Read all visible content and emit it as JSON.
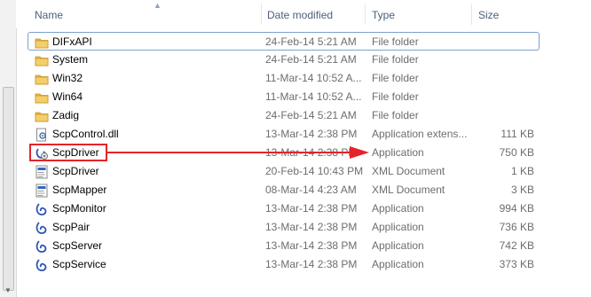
{
  "header": {
    "name": "Name",
    "date": "Date modified",
    "type": "Type",
    "size": "Size"
  },
  "rows": [
    {
      "name": "DIFxAPI",
      "date": "24-Feb-14 5:21 AM",
      "type": "File folder",
      "size": "",
      "icon": "folder-icon"
    },
    {
      "name": "System",
      "date": "24-Feb-14 5:21 AM",
      "type": "File folder",
      "size": "",
      "icon": "folder-icon"
    },
    {
      "name": "Win32",
      "date": "11-Mar-14 10:52 A...",
      "type": "File folder",
      "size": "",
      "icon": "folder-icon"
    },
    {
      "name": "Win64",
      "date": "11-Mar-14 10:52 A...",
      "type": "File folder",
      "size": "",
      "icon": "folder-icon"
    },
    {
      "name": "Zadig",
      "date": "24-Feb-14 5:21 AM",
      "type": "File folder",
      "size": "",
      "icon": "folder-icon"
    },
    {
      "name": "ScpControl.dll",
      "date": "13-Mar-14 2:38 PM",
      "type": "Application extens...",
      "size": "111 KB",
      "icon": "dll-icon"
    },
    {
      "name": "ScpDriver",
      "date": "13-Mar-14 2:38 PM",
      "type": "Application",
      "size": "750 KB",
      "icon": "installer-app-icon"
    },
    {
      "name": "ScpDriver",
      "date": "20-Feb-14 10:43 PM",
      "type": "XML Document",
      "size": "1 KB",
      "icon": "xml-icon"
    },
    {
      "name": "ScpMapper",
      "date": "08-Mar-14 4:23 AM",
      "type": "XML Document",
      "size": "3 KB",
      "icon": "xml-icon"
    },
    {
      "name": "ScpMonitor",
      "date": "13-Mar-14 2:38 PM",
      "type": "Application",
      "size": "994 KB",
      "icon": "app-icon"
    },
    {
      "name": "ScpPair",
      "date": "13-Mar-14 2:38 PM",
      "type": "Application",
      "size": "736 KB",
      "icon": "app-icon"
    },
    {
      "name": "ScpServer",
      "date": "13-Mar-14 2:38 PM",
      "type": "Application",
      "size": "742 KB",
      "icon": "app-icon"
    },
    {
      "name": "ScpService",
      "date": "13-Mar-14 2:38 PM",
      "type": "Application",
      "size": "373 KB",
      "icon": "app-icon"
    }
  ],
  "colors": {
    "folder": "#e8b84a",
    "callout": "#e4242b",
    "header_text": "#4c607a",
    "selection_border": "#7da2ce"
  }
}
